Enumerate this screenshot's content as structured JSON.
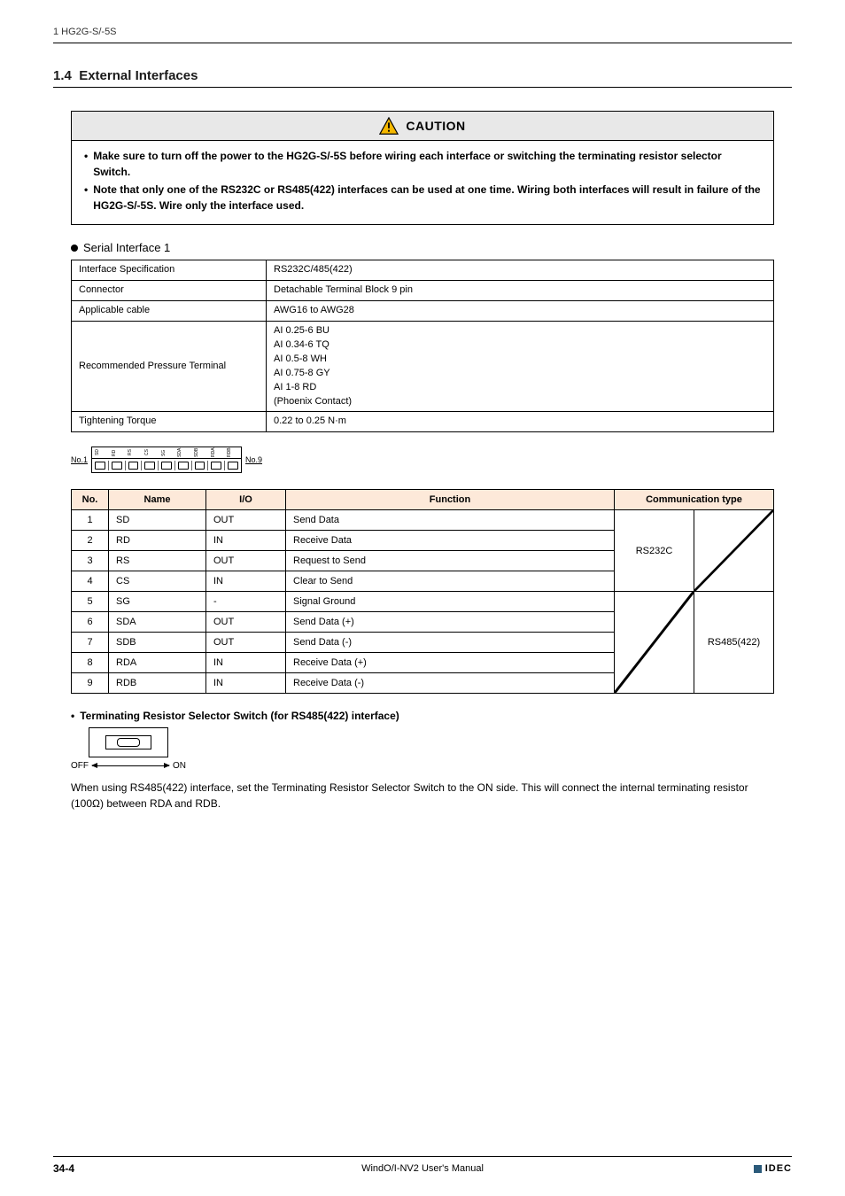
{
  "header": {
    "chapter": "1 HG2G-S/-5S"
  },
  "section": {
    "number": "1.4",
    "title": "External Interfaces"
  },
  "caution": {
    "label": "CAUTION",
    "items": [
      "Make sure to turn off the power to the HG2G-S/-5S before wiring each interface or switching the terminating resistor selector Switch.",
      "Note that only one of the RS232C or RS485(422) interfaces can be used at one time. Wiring both interfaces will result in failure of the HG2G-S/-5S. Wire only the interface used."
    ]
  },
  "serial": {
    "heading": "Serial Interface 1",
    "spec": {
      "rows": [
        {
          "label": "Interface Specification",
          "value": "RS232C/485(422)"
        },
        {
          "label": "Connector",
          "value": "Detachable Terminal Block 9 pin"
        },
        {
          "label": "Applicable cable",
          "value": "AWG16 to AWG28"
        },
        {
          "label": "Recommended Pressure Terminal",
          "value": "AI 0.25-6 BU\nAI 0.34-6 TQ\nAI 0.5-8 WH\nAI 0.75-8 GY\nAI 1-8 RD\n(Phoenix Contact)"
        },
        {
          "label": "Tightening Torque",
          "value": "0.22 to 0.25 N·m"
        }
      ]
    },
    "terminal_figure": {
      "left_label": "No.1",
      "right_label": "No.9",
      "pin_labels": [
        "SD",
        "RD",
        "RS",
        "CS",
        "SG",
        "SDA",
        "SDB",
        "RDA",
        "RDB"
      ]
    },
    "signals": {
      "headers": {
        "no": "No.",
        "name": "Name",
        "io": "I/O",
        "function": "Function",
        "comm": "Communication type"
      },
      "rows": [
        {
          "no": "1",
          "name": "SD",
          "io": "OUT",
          "function": "Send Data"
        },
        {
          "no": "2",
          "name": "RD",
          "io": "IN",
          "function": "Receive Data"
        },
        {
          "no": "3",
          "name": "RS",
          "io": "OUT",
          "function": "Request to Send"
        },
        {
          "no": "4",
          "name": "CS",
          "io": "IN",
          "function": "Clear to Send"
        },
        {
          "no": "5",
          "name": "SG",
          "io": "-",
          "function": "Signal Ground"
        },
        {
          "no": "6",
          "name": "SDA",
          "io": "OUT",
          "function": "Send Data (+)"
        },
        {
          "no": "7",
          "name": "SDB",
          "io": "OUT",
          "function": "Send Data (-)"
        },
        {
          "no": "8",
          "name": "RDA",
          "io": "IN",
          "function": "Receive Data (+)"
        },
        {
          "no": "9",
          "name": "RDB",
          "io": "IN",
          "function": "Receive Data (-)"
        }
      ],
      "comm_groups": {
        "rs232c": "RS232C",
        "rs485": "RS485(422)"
      }
    }
  },
  "term_switch": {
    "heading": "Terminating Resistor Selector Switch (for RS485(422) interface)",
    "off": "OFF",
    "on": "ON",
    "note": "When using RS485(422) interface, set the Terminating Resistor Selector Switch to the ON side. This will connect the internal terminating resistor (100Ω) between RDA and RDB."
  },
  "footer": {
    "page": "34-4",
    "title": "WindO/I-NV2 User's Manual",
    "brand": "IDEC"
  }
}
